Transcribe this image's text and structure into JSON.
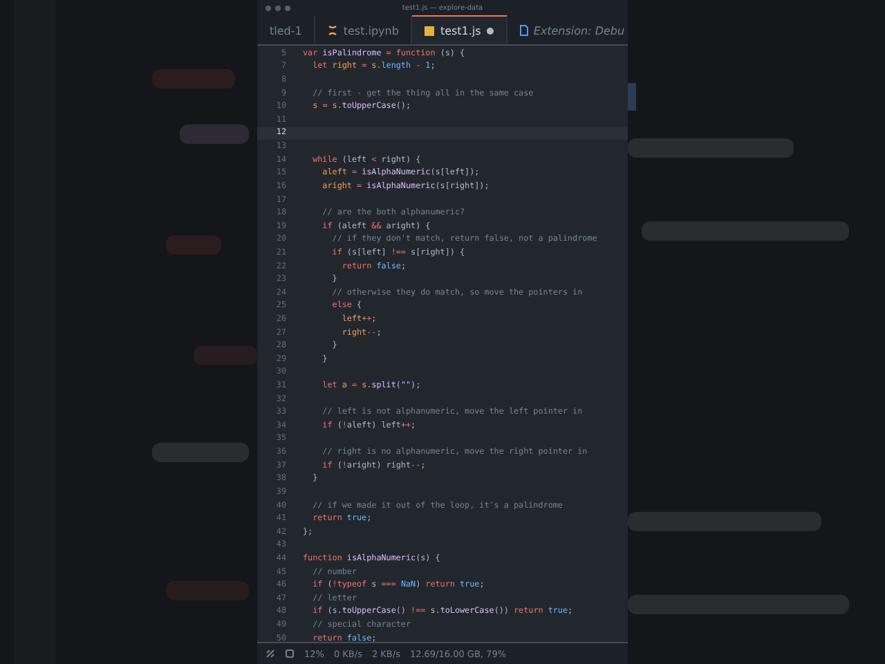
{
  "window": {
    "title": "test1.js — explore-data"
  },
  "tabs": [
    {
      "label": "tled-1",
      "kind": "plain",
      "selected": false,
      "modified": false,
      "italic": false
    },
    {
      "label": "test.ipynb",
      "kind": "notebook",
      "selected": false,
      "modified": false,
      "italic": false
    },
    {
      "label": "test1.js",
      "kind": "js",
      "selected": true,
      "modified": true,
      "italic": false
    },
    {
      "label": "Extension: Debu",
      "kind": "doc",
      "selected": false,
      "modified": false,
      "italic": true
    }
  ],
  "editor": {
    "lines": [
      {
        "n": "5",
        "current": false,
        "t": [
          {
            "kind": "kw",
            "text": "var "
          },
          {
            "kind": "fn",
            "text": "isPalindrome"
          },
          {
            "kind": "op",
            "text": " = "
          },
          {
            "kind": "kw",
            "text": "function "
          },
          {
            "kind": "p",
            "text": "(s) {"
          }
        ]
      },
      {
        "n": "7",
        "current": false,
        "t": [
          {
            "kind": "kw",
            "text": "  let "
          },
          {
            "kind": "v",
            "text": "right "
          },
          {
            "kind": "op",
            "text": "= "
          },
          {
            "kind": "v",
            "text": "s."
          },
          {
            "kind": "num",
            "text": "length"
          },
          {
            "kind": "op",
            "text": " - "
          },
          {
            "kind": "num",
            "text": "1"
          },
          {
            "kind": "p",
            "text": ";"
          }
        ]
      },
      {
        "n": "8",
        "current": false
      },
      {
        "n": "9",
        "current": false,
        "t": [
          {
            "kind": "cm",
            "text": "  // first - get the thing all in the same case"
          }
        ]
      },
      {
        "n": "10",
        "current": false,
        "t": [
          {
            "kind": "v",
            "text": "  s "
          },
          {
            "kind": "op",
            "text": "= "
          },
          {
            "kind": "v",
            "text": "s."
          },
          {
            "kind": "fn",
            "text": "toUpperCase"
          },
          {
            "kind": "p",
            "text": "();"
          }
        ]
      },
      {
        "n": "11",
        "current": false
      },
      {
        "n": "12",
        "current": true
      },
      {
        "n": "13",
        "current": false
      },
      {
        "n": "14",
        "current": false,
        "t": [
          {
            "kind": "kw",
            "text": "  while "
          },
          {
            "kind": "p",
            "text": "(left "
          },
          {
            "kind": "op",
            "text": "< "
          },
          {
            "kind": "p",
            "text": "right) {"
          }
        ]
      },
      {
        "n": "15",
        "current": false,
        "t": [
          {
            "kind": "v",
            "text": "    aleft "
          },
          {
            "kind": "op",
            "text": "= "
          },
          {
            "kind": "fn",
            "text": "isAlphaNumeric"
          },
          {
            "kind": "p",
            "text": "(s[left]);"
          }
        ]
      },
      {
        "n": "16",
        "current": false,
        "t": [
          {
            "kind": "v",
            "text": "    aright "
          },
          {
            "kind": "op",
            "text": "= "
          },
          {
            "kind": "fn",
            "text": "isAlphaNumeric"
          },
          {
            "kind": "p",
            "text": "(s[right]);"
          }
        ]
      },
      {
        "n": "17",
        "current": false
      },
      {
        "n": "18",
        "current": false,
        "t": [
          {
            "kind": "cm",
            "text": "    // are the both alphanumeric?"
          }
        ]
      },
      {
        "n": "19",
        "current": false,
        "t": [
          {
            "kind": "kw",
            "text": "    if "
          },
          {
            "kind": "p",
            "text": "(aleft "
          },
          {
            "kind": "op",
            "text": "&& "
          },
          {
            "kind": "p",
            "text": "aright) {"
          }
        ]
      },
      {
        "n": "20",
        "current": false,
        "t": [
          {
            "kind": "cm",
            "text": "      // if they don't match, return false, not a palindrome"
          }
        ]
      },
      {
        "n": "21",
        "current": false,
        "t": [
          {
            "kind": "kw",
            "text": "      if "
          },
          {
            "kind": "p",
            "text": "(s[left] "
          },
          {
            "kind": "op",
            "text": "!== "
          },
          {
            "kind": "p",
            "text": "s[right]) {"
          }
        ]
      },
      {
        "n": "22",
        "current": false,
        "t": [
          {
            "kind": "kw",
            "text": "        return "
          },
          {
            "kind": "num",
            "text": "false"
          },
          {
            "kind": "p",
            "text": ";"
          }
        ]
      },
      {
        "n": "23",
        "current": false,
        "t": [
          {
            "kind": "p",
            "text": "      }"
          }
        ]
      },
      {
        "n": "24",
        "current": false,
        "t": [
          {
            "kind": "cm",
            "text": "      // otherwise they do match, so move the pointers in"
          }
        ]
      },
      {
        "n": "25",
        "current": false,
        "t": [
          {
            "kind": "kw",
            "text": "      else "
          },
          {
            "kind": "p",
            "text": "{"
          }
        ]
      },
      {
        "n": "26",
        "current": false,
        "t": [
          {
            "kind": "v",
            "text": "        left"
          },
          {
            "kind": "op",
            "text": "++"
          },
          {
            "kind": "p",
            "text": ";"
          }
        ]
      },
      {
        "n": "27",
        "current": false,
        "t": [
          {
            "kind": "v",
            "text": "        right"
          },
          {
            "kind": "op",
            "text": "--"
          },
          {
            "kind": "p",
            "text": ";"
          }
        ]
      },
      {
        "n": "28",
        "current": false,
        "t": [
          {
            "kind": "p",
            "text": "      }"
          }
        ]
      },
      {
        "n": "29",
        "current": false,
        "t": [
          {
            "kind": "p",
            "text": "    }"
          }
        ]
      },
      {
        "n": "30",
        "current": false
      },
      {
        "n": "31",
        "current": false,
        "t": [
          {
            "kind": "kw",
            "text": "    let "
          },
          {
            "kind": "v",
            "text": "a "
          },
          {
            "kind": "op",
            "text": "= "
          },
          {
            "kind": "v",
            "text": "s."
          },
          {
            "kind": "fn",
            "text": "split"
          },
          {
            "kind": "p",
            "text": "("
          },
          {
            "kind": "str",
            "text": "\"\""
          },
          {
            "kind": "p",
            "text": ");"
          }
        ]
      },
      {
        "n": "32",
        "current": false
      },
      {
        "n": "33",
        "current": false,
        "t": [
          {
            "kind": "cm",
            "text": "    // left is not alphanumeric, move the left pointer in"
          }
        ]
      },
      {
        "n": "34",
        "current": false,
        "t": [
          {
            "kind": "kw",
            "text": "    if "
          },
          {
            "kind": "p",
            "text": "("
          },
          {
            "kind": "op",
            "text": "!"
          },
          {
            "kind": "p",
            "text": "aleft) left"
          },
          {
            "kind": "op",
            "text": "++"
          },
          {
            "kind": "p",
            "text": ";"
          }
        ]
      },
      {
        "n": "35",
        "current": false
      },
      {
        "n": "36",
        "current": false,
        "t": [
          {
            "kind": "cm",
            "text": "    // right is no alphanumeric, move the right pointer in"
          }
        ]
      },
      {
        "n": "37",
        "current": false,
        "t": [
          {
            "kind": "kw",
            "text": "    if "
          },
          {
            "kind": "p",
            "text": "("
          },
          {
            "kind": "op",
            "text": "!"
          },
          {
            "kind": "p",
            "text": "aright) right"
          },
          {
            "kind": "op",
            "text": "--"
          },
          {
            "kind": "p",
            "text": ";"
          }
        ]
      },
      {
        "n": "38",
        "current": false,
        "t": [
          {
            "kind": "p",
            "text": "  }"
          }
        ]
      },
      {
        "n": "39",
        "current": false
      },
      {
        "n": "40",
        "current": false,
        "t": [
          {
            "kind": "cm",
            "text": "  // if we made it out of the loop, it's a palindrome"
          }
        ]
      },
      {
        "n": "41",
        "current": false,
        "t": [
          {
            "kind": "kw",
            "text": "  return "
          },
          {
            "kind": "num",
            "text": "true"
          },
          {
            "kind": "p",
            "text": ";"
          }
        ]
      },
      {
        "n": "42",
        "current": false,
        "t": [
          {
            "kind": "p",
            "text": "};"
          }
        ]
      },
      {
        "n": "43",
        "current": false
      },
      {
        "n": "44",
        "current": false,
        "t": [
          {
            "kind": "kw",
            "text": "function "
          },
          {
            "kind": "fn",
            "text": "isAlphaNumeric"
          },
          {
            "kind": "p",
            "text": "(s) {"
          }
        ]
      },
      {
        "n": "45",
        "current": false,
        "t": [
          {
            "kind": "cm",
            "text": "  // number"
          }
        ]
      },
      {
        "n": "46",
        "current": false,
        "t": [
          {
            "kind": "kw",
            "text": "  if "
          },
          {
            "kind": "p",
            "text": "("
          },
          {
            "kind": "op",
            "text": "!"
          },
          {
            "kind": "kw",
            "text": "typeof "
          },
          {
            "kind": "p",
            "text": "s "
          },
          {
            "kind": "op",
            "text": "=== "
          },
          {
            "kind": "num",
            "text": "NaN"
          },
          {
            "kind": "p",
            "text": ") "
          },
          {
            "kind": "kw",
            "text": "return "
          },
          {
            "kind": "num",
            "text": "true"
          },
          {
            "kind": "p",
            "text": ";"
          }
        ]
      },
      {
        "n": "47",
        "current": false,
        "t": [
          {
            "kind": "cm",
            "text": "  // letter"
          }
        ]
      },
      {
        "n": "48",
        "current": false,
        "t": [
          {
            "kind": "kw",
            "text": "  if "
          },
          {
            "kind": "p",
            "text": "(s."
          },
          {
            "kind": "fn",
            "text": "toUpperCase"
          },
          {
            "kind": "p",
            "text": "() "
          },
          {
            "kind": "op",
            "text": "!== "
          },
          {
            "kind": "p",
            "text": "s."
          },
          {
            "kind": "fn",
            "text": "toLowerCase"
          },
          {
            "kind": "p",
            "text": "()) "
          },
          {
            "kind": "kw",
            "text": "return "
          },
          {
            "kind": "num",
            "text": "true"
          },
          {
            "kind": "p",
            "text": ";"
          }
        ]
      },
      {
        "n": "49",
        "current": false,
        "t": [
          {
            "kind": "cm",
            "text": "  // special character"
          }
        ]
      },
      {
        "n": "50",
        "current": false,
        "t": [
          {
            "kind": "kw",
            "text": "  return "
          },
          {
            "kind": "num",
            "text": "false"
          },
          {
            "kind": "p",
            "text": ";"
          }
        ]
      }
    ]
  },
  "status_bar": {
    "cpu": "12%",
    "upload": "0 KB/s",
    "download": "2 KB/s",
    "memory": "12.69/16.00 GB, 79%"
  }
}
